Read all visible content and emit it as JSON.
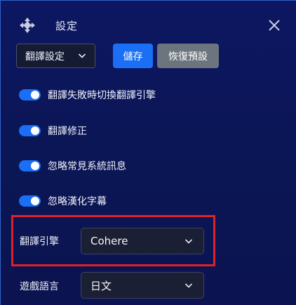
{
  "header": {
    "title": "設定"
  },
  "toolbar": {
    "section_select": "翻譯設定",
    "save_label": "儲存",
    "reset_label": "恢復預設"
  },
  "toggles": [
    {
      "label": "翻譯失敗時切換翻譯引擎",
      "on": true
    },
    {
      "label": "翻譯修正",
      "on": true
    },
    {
      "label": "忽略常見系統訊息",
      "on": true
    },
    {
      "label": "忽略漢化字幕",
      "on": true
    }
  ],
  "fields": {
    "engine": {
      "label": "翻譯引擎",
      "value": "Cohere"
    },
    "game_language": {
      "label": "遊戲語言",
      "value": "日文"
    }
  },
  "colors": {
    "accent": "#1a6ff4",
    "secondary": "#6c757d",
    "highlight": "#e0202a",
    "background": "#0b1656"
  },
  "icons": {
    "move": "move-arrows-icon",
    "close": "close-icon",
    "chevron": "chevron-down-icon"
  }
}
